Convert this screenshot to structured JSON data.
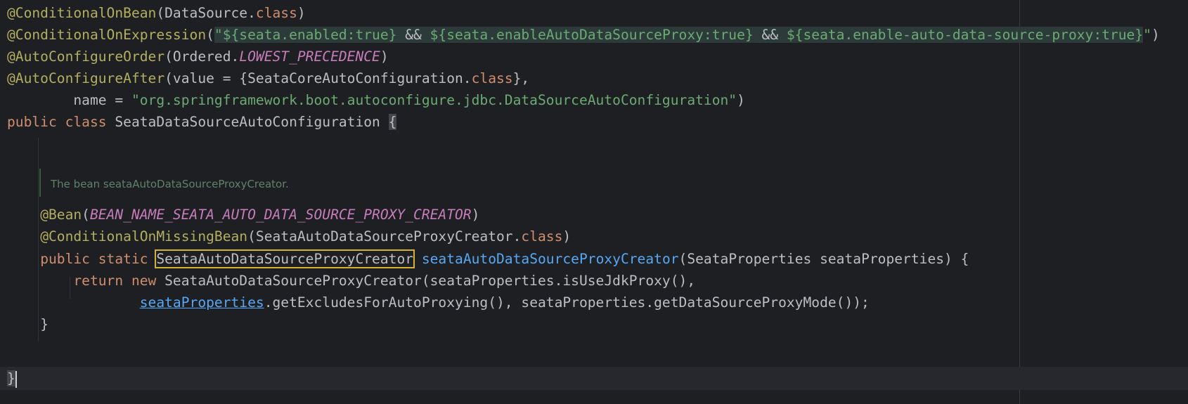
{
  "code": {
    "l1": {
      "a": "@ConditionalOnBean",
      "b": "(DataSource.",
      "c": "class",
      "d": ")"
    },
    "l2": {
      "a": "@ConditionalOnExpression",
      "b": "(",
      "s1": "\"${seata.enabled:true}",
      "op1": " && ",
      "s2": "${seata.enableAutoDataSourceProxy:true}",
      "op2": " && ",
      "s3": "${seata.enable-auto-data-source-proxy:true}",
      "q": "\"",
      "e": ")"
    },
    "l3": {
      "a": "@AutoConfigureOrder",
      "b": "(Ordered.",
      "c": "LOWEST_PRECEDENCE",
      "d": ")"
    },
    "l4": {
      "a": "@AutoConfigureAfter",
      "b": "(value = {SeataCoreAutoConfiguration.",
      "c": "class",
      "d": "},"
    },
    "l5": {
      "a": "        name = ",
      "s": "\"org.springframework.boot.autoconfigure.jdbc.DataSourceAutoConfiguration\"",
      "d": ")"
    },
    "l6": {
      "k1": "public",
      "sp1": " ",
      "k2": "class",
      "name": " SeataDataSourceAutoConfiguration ",
      "brace": "{"
    },
    "doc": "The bean seataAutoDataSourceProxyCreator.",
    "l7": {
      "ind": "    ",
      "a": "@Bean",
      "b": "(",
      "c": "BEAN_NAME_SEATA_AUTO_DATA_SOURCE_PROXY_CREATOR",
      "d": ")"
    },
    "l8": {
      "ind": "    ",
      "a": "@ConditionalOnMissingBean",
      "b": "(SeataAutoDataSourceProxyCreator.",
      "c": "class",
      "d": ")"
    },
    "l9": {
      "ind": "    ",
      "k1": "public",
      "sp1": " ",
      "k2": "static",
      "sp2": " ",
      "type": "SeataAutoDataSourceProxyCreator",
      "sp3": " ",
      "m": "seataAutoDataSourceProxyCreator",
      "rest": "(SeataProperties seataProperties) {"
    },
    "l10": {
      "ind": "        ",
      "k1": "return",
      "sp1": " ",
      "k2": "new",
      "rest": " SeataAutoDataSourceProxyCreator(seataProperties.isUseJdkProxy(),"
    },
    "l11": {
      "ind": "                ",
      "link": "seataProperties",
      "rest": ".getExcludesForAutoProxying(), seataProperties.getDataSourceProxyMode());"
    },
    "l12": {
      "ind": "    ",
      "a": "}"
    },
    "l13": {
      "a": "}"
    }
  }
}
